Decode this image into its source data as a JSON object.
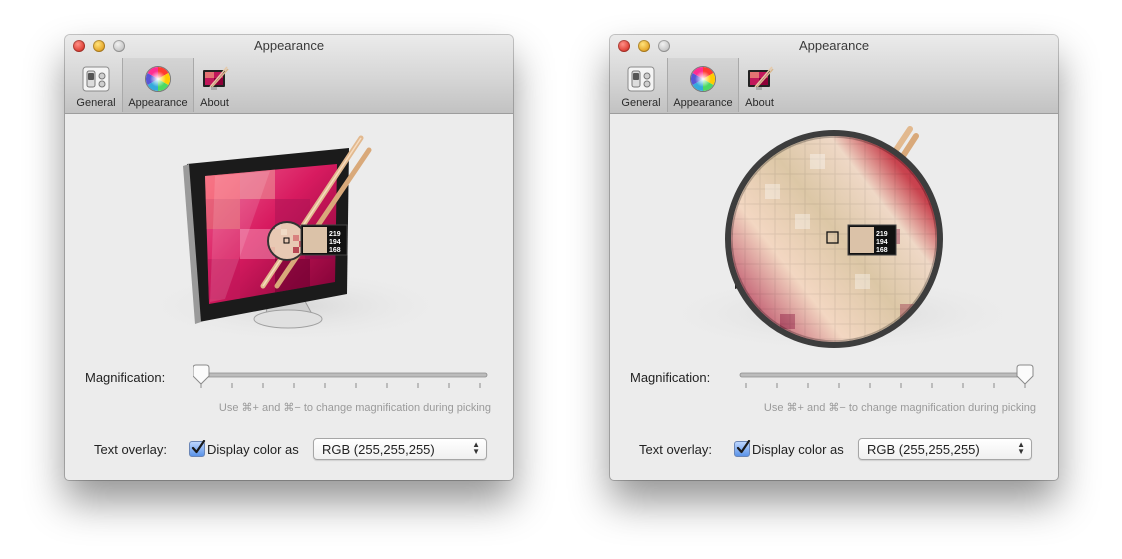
{
  "windows": [
    {
      "title": "Appearance",
      "toolbar": {
        "general": "General",
        "appearance": "Appearance",
        "about": "About"
      },
      "magnification_label": "Magnification:",
      "magnification_value": 0,
      "hint": "Use ⌘+ and ⌘− to change magnification during picking",
      "text_overlay_label": "Text overlay:",
      "display_color_label": "Display color as",
      "display_color_checked": true,
      "color_format": "RGB (255,255,255)",
      "overlay_values": [
        "219",
        "194",
        "168"
      ]
    },
    {
      "title": "Appearance",
      "toolbar": {
        "general": "General",
        "appearance": "Appearance",
        "about": "About"
      },
      "magnification_label": "Magnification:",
      "magnification_value": 1,
      "hint": "Use ⌘+ and ⌘− to change magnification during picking",
      "text_overlay_label": "Text overlay:",
      "display_color_label": "Display color as",
      "display_color_checked": true,
      "color_format": "RGB (255,255,255)",
      "overlay_values": [
        "219",
        "194",
        "168"
      ]
    }
  ],
  "colors": {
    "swatch": "#dbc2a8",
    "accent": "#4a8bdf"
  },
  "icons": {
    "general": "switch-icon",
    "appearance": "color-wheel-icon",
    "about": "app-icon"
  }
}
